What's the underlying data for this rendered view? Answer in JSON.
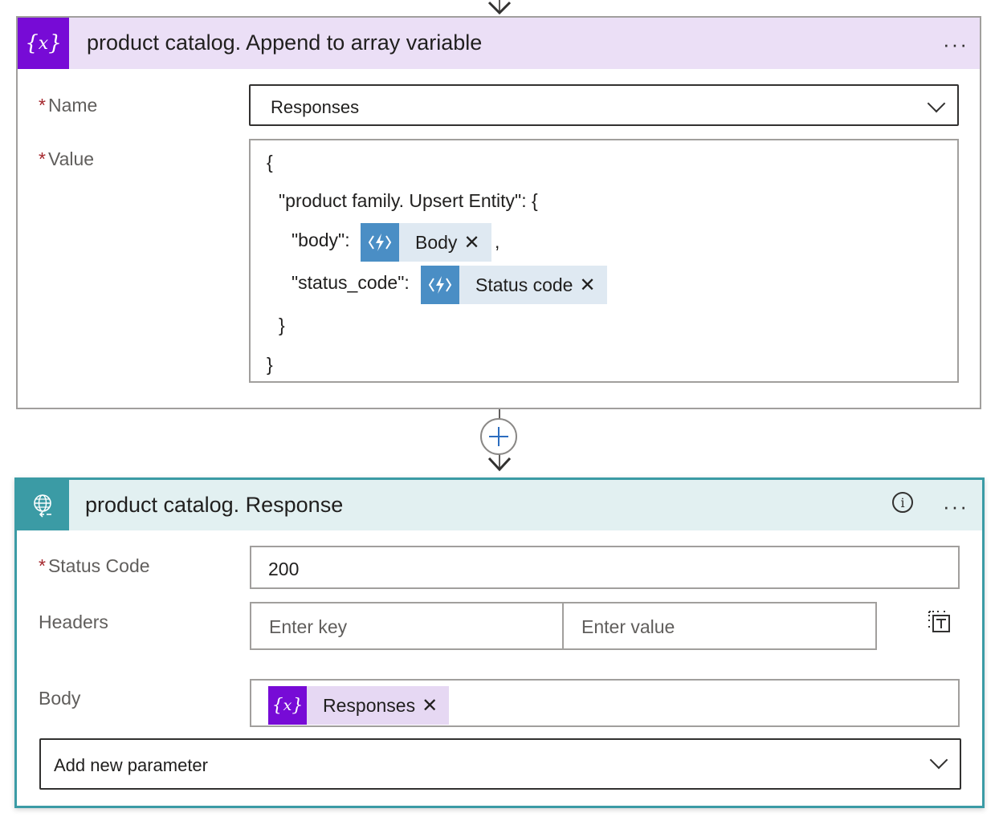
{
  "append_card": {
    "title": "product catalog. Append to array variable",
    "more_label": "···",
    "name_field": {
      "label": "Name",
      "required_mark": "*",
      "value": "Responses"
    },
    "value_field": {
      "label": "Value",
      "required_mark": "*",
      "lines": {
        "open_brace": "{",
        "entity_key": "\"product family. Upsert Entity\": {",
        "body_key": "\"body\":",
        "status_key": "\"status_code\":",
        "comma": ",",
        "inner_close": "}",
        "outer_close": "}"
      },
      "tokens": {
        "body": {
          "label": "Body",
          "remove": "✕"
        },
        "status_code": {
          "label": "Status code",
          "remove": "✕"
        }
      }
    }
  },
  "response_card": {
    "title": "product catalog. Response",
    "more_label": "···",
    "info_label": "i",
    "status_code": {
      "label": "Status Code",
      "required_mark": "*",
      "value": "200"
    },
    "headers": {
      "label": "Headers",
      "key_placeholder": "Enter key",
      "value_placeholder": "Enter value"
    },
    "body": {
      "label": "Body",
      "token": {
        "label": "Responses",
        "remove": "✕"
      }
    },
    "add_parameter": {
      "label": "Add new parameter"
    }
  },
  "colors": {
    "variable_purple": "#770bd6",
    "variable_header_bg": "#ebdff6",
    "response_teal": "#3b9ba5",
    "response_header_bg": "#e2f0f1",
    "token_blue": "#4a8ec5",
    "token_bg": "#dfe9f2",
    "required_red": "#a4262c"
  },
  "icons": {
    "variable": "variable-icon",
    "function": "azure-function-icon",
    "response": "globe-response-icon",
    "plus": "plus-icon",
    "switch_mode": "switch-text-mode-icon"
  }
}
